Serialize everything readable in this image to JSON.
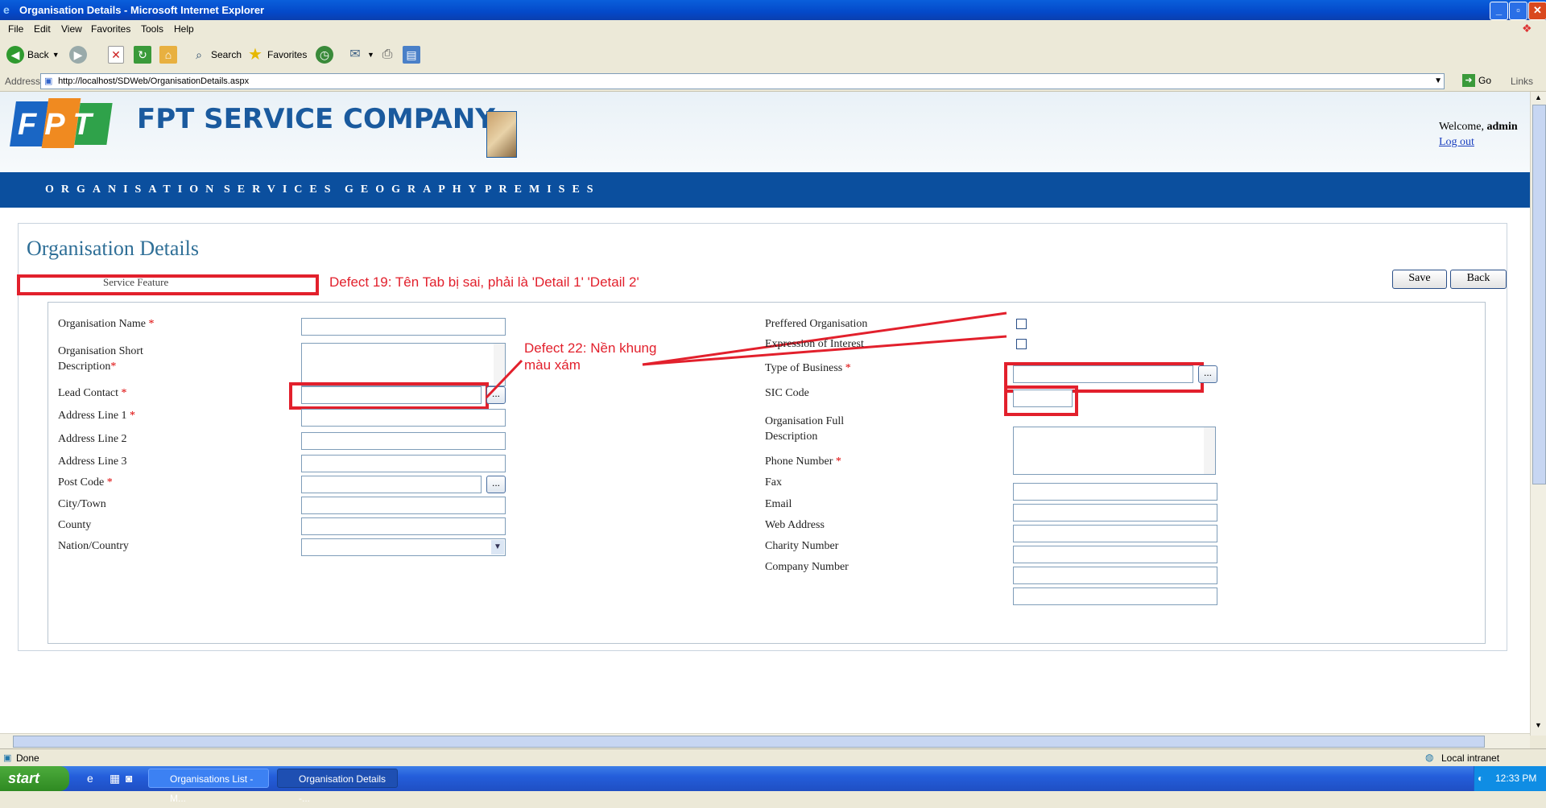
{
  "window": {
    "title": "Organisation Details - Microsoft Internet Explorer"
  },
  "menu": [
    "File",
    "Edit",
    "View",
    "Favorites",
    "Tools",
    "Help"
  ],
  "toolbar": {
    "back": "Back",
    "search": "Search",
    "favorites": "Favorites"
  },
  "address": {
    "label": "Address",
    "url": "http://localhost/SDWeb/OrganisationDetails.aspx",
    "go": "Go",
    "links": "Links"
  },
  "site": {
    "brand": "FPT SERVICE COMPANY",
    "logo_text": "FPT",
    "welcome_prefix": "Welcome,",
    "user": "admin",
    "logout": "Log out",
    "nav": [
      "ORGANISATION",
      "SERVICES",
      "GEOGRAPHY",
      "PREMISES"
    ]
  },
  "page": {
    "title": "Organisation Details",
    "tab": "Service Feature",
    "save": "Save",
    "back": "Back"
  },
  "form_left": {
    "org_name": "Organisation Name",
    "short_desc_1": "Organisation Short",
    "short_desc_2": "Description",
    "lead_contact": "Lead Contact",
    "addr1": "Address Line 1",
    "addr2": "Address Line 2",
    "addr3": "Address Line 3",
    "post_code": "Post Code",
    "city": "City/Town",
    "county": "County",
    "nation": "Nation/Country",
    "required_mark": "*"
  },
  "form_right": {
    "preferred": "Preffered Organisation",
    "expression": "Expression of Interest",
    "type_business": "Type of Business",
    "sic": "SIC Code",
    "full_desc_1": "Organisation Full",
    "full_desc_2": "Description",
    "phone": "Phone Number",
    "fax": "Fax",
    "email": "Email",
    "web": "Web Address",
    "charity": "Charity Number",
    "company": "Company Number"
  },
  "annotations": {
    "defect19": "Defect 19: Tên Tab bị sai, phải là  'Detail 1' 'Detail 2'",
    "defect22_1": "Defect 22: Nền khung",
    "defect22_2": "màu xám"
  },
  "status": {
    "text": "Done",
    "zone": "Local intranet"
  },
  "taskbar": {
    "start": "start",
    "tasks": [
      "Organisations List - M...",
      "Organisation Details -..."
    ],
    "time": "12:33 PM"
  },
  "colors": {
    "nav_bg": "#0B4F9E",
    "title_color": "#2f6f97",
    "annotation_red": "#e2202c"
  }
}
